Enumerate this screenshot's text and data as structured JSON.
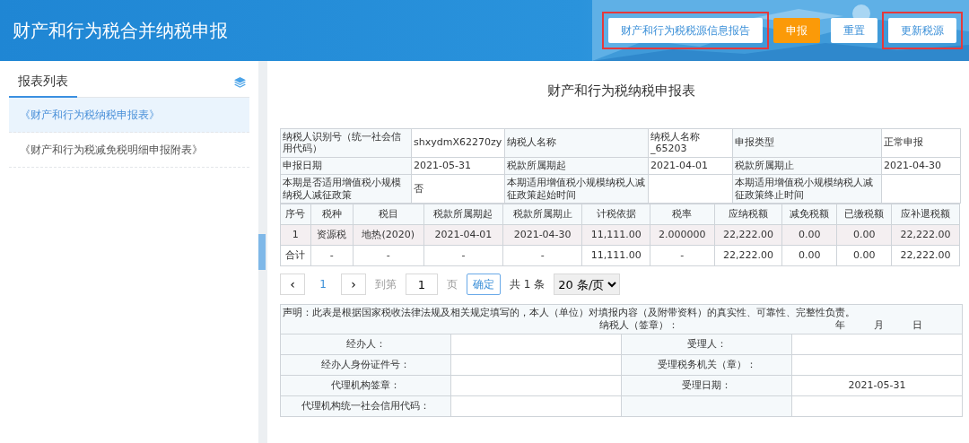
{
  "header": {
    "title": "财产和行为税合并纳税申报",
    "buttons": [
      {
        "label": "财产和行为税税源信息报告",
        "kind": "default",
        "highlighted": true
      },
      {
        "label": "申报",
        "kind": "primary",
        "highlighted": false
      },
      {
        "label": "重置",
        "kind": "default",
        "highlighted": false
      },
      {
        "label": "更新税源",
        "kind": "default",
        "highlighted": true
      }
    ]
  },
  "sidebar": {
    "title": "报表列表",
    "items": [
      {
        "label": "《财产和行为税纳税申报表》",
        "selected": true
      },
      {
        "label": "《财产和行为税减免税明细申报附表》",
        "selected": false
      }
    ]
  },
  "form": {
    "title": "财产和行为税纳税申报表",
    "info_rows": [
      [
        {
          "label": "纳税人识别号（统一社会信用代码）",
          "value": "shxydmX62270zy"
        },
        {
          "label": "纳税人名称",
          "value": "纳税人名称_65203"
        },
        {
          "label": "申报类型",
          "value": "正常申报"
        }
      ],
      [
        {
          "label": "申报日期",
          "value": "2021-05-31"
        },
        {
          "label": "税款所属期起",
          "value": "2021-04-01"
        },
        {
          "label": "税款所属期止",
          "value": "2021-04-30"
        }
      ],
      [
        {
          "label": "本期是否适用增值税小规模纳税人减征政策",
          "value": "否"
        },
        {
          "label": "本期适用增值税小规模纳税人减征政策起始时间"
        },
        {
          "label": "本期适用增值税小规模纳税人减征政策终止时间"
        }
      ]
    ],
    "columns": [
      "序号",
      "税种",
      "税目",
      "税款所属期起",
      "税款所属期止",
      "计税依据",
      "税率",
      "应纳税额",
      "减免税额",
      "已缴税额",
      "应补退税额"
    ],
    "rows": [
      {
        "highlighted": true,
        "cells": [
          "1",
          "资源税",
          "地热(2020)",
          "2021-04-01",
          "2021-04-30",
          "11,111.00",
          "2.000000",
          "22,222.00",
          "0.00",
          "0.00",
          "22,222.00"
        ]
      },
      {
        "highlighted": false,
        "cells": [
          "合计",
          "-",
          "-",
          "-",
          "-",
          "11,111.00",
          "-",
          "22,222.00",
          "0.00",
          "0.00",
          "22,222.00"
        ]
      }
    ]
  },
  "pagination": {
    "prev": "‹",
    "page": "1",
    "next": "›",
    "goto_label": "到第",
    "page_input": "1",
    "page_unit": "页",
    "confirm": "确定",
    "total": "共 1 条",
    "page_size": "20 条/页"
  },
  "declaration": {
    "statement": "声明：此表是根据国家税收法律法规及相关规定填写的，本人（单位）对填报内容（及附带资料）的真实性、可靠性、完整性负责。",
    "signer": "纳税人（签章）：",
    "date_parts": [
      "年",
      "月",
      "日"
    ],
    "rows": [
      {
        "label": "经办人：",
        "label_2": "受理人："
      },
      {
        "label": "经办人身份证件号：",
        "label_2": "受理税务机关（章）："
      },
      {
        "label": "代理机构签章：",
        "label_2": "受理日期：",
        "value_2": "2021-05-31"
      },
      {
        "label": "代理机构统一社会信用代码："
      }
    ]
  }
}
